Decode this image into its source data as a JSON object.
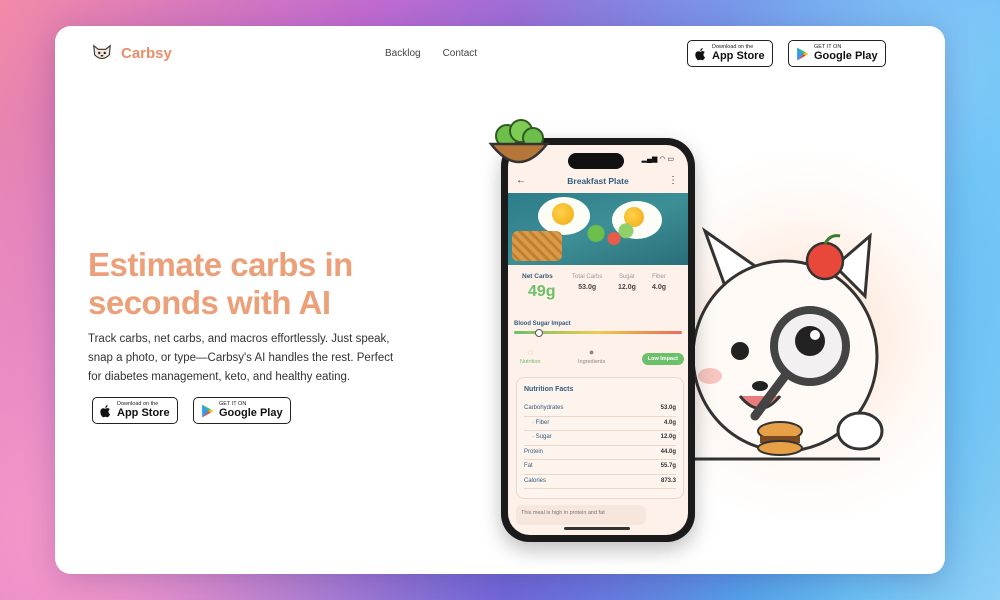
{
  "brand": {
    "name": "Carbsy",
    "logo_icon": "dog-face-icon"
  },
  "nav": {
    "links": [
      "Backlog",
      "Contact"
    ]
  },
  "stores": {
    "apple": {
      "small": "Download on the",
      "big": "App Store",
      "icon": "apple-icon"
    },
    "google": {
      "small": "GET IT ON",
      "big": "Google Play",
      "icon": "google-play-icon"
    }
  },
  "hero": {
    "title": "Estimate carbs in seconds with AI",
    "subtitle": "Track carbs, net carbs, and macros effortlessly. Just speak, snap a photo, or type—Carbsy's AI handles the rest. Perfect for diabetes management, keto, and healthy eating."
  },
  "phone": {
    "screen_title": "Breakfast Plate",
    "net_carbs_label": "Net Carbs",
    "net_carbs_value": "49g",
    "macros": [
      {
        "label": "Total Carbs",
        "value": "53.0g"
      },
      {
        "label": "Sugar",
        "value": "12.0g"
      },
      {
        "label": "Fiber",
        "value": "4.0g"
      }
    ],
    "blood_sugar_label": "Blood Sugar Impact",
    "blood_sugar_level": 0.15,
    "tabs": [
      {
        "label": "Nutrition",
        "icon": "leaf-icon"
      },
      {
        "label": "Ingredients",
        "icon": "apple-icon"
      }
    ],
    "impact_badge": "Low Impact",
    "facts_title": "Nutrition Facts",
    "facts": [
      {
        "label": "Carbohydrates",
        "value": "53.0g"
      },
      {
        "label": "· Fiber",
        "value": "4.0g"
      },
      {
        "label": "· Sugar",
        "value": "12.0g"
      },
      {
        "label": "Protein",
        "value": "44.0g"
      },
      {
        "label": "Fat",
        "value": "55.7g"
      },
      {
        "label": "Calories",
        "value": "873.3"
      }
    ],
    "bottom_note": "This meal is high in protein and fat"
  },
  "colors": {
    "accent": "#eca07a",
    "green": "#6cc06a",
    "navy": "#355c7d"
  }
}
